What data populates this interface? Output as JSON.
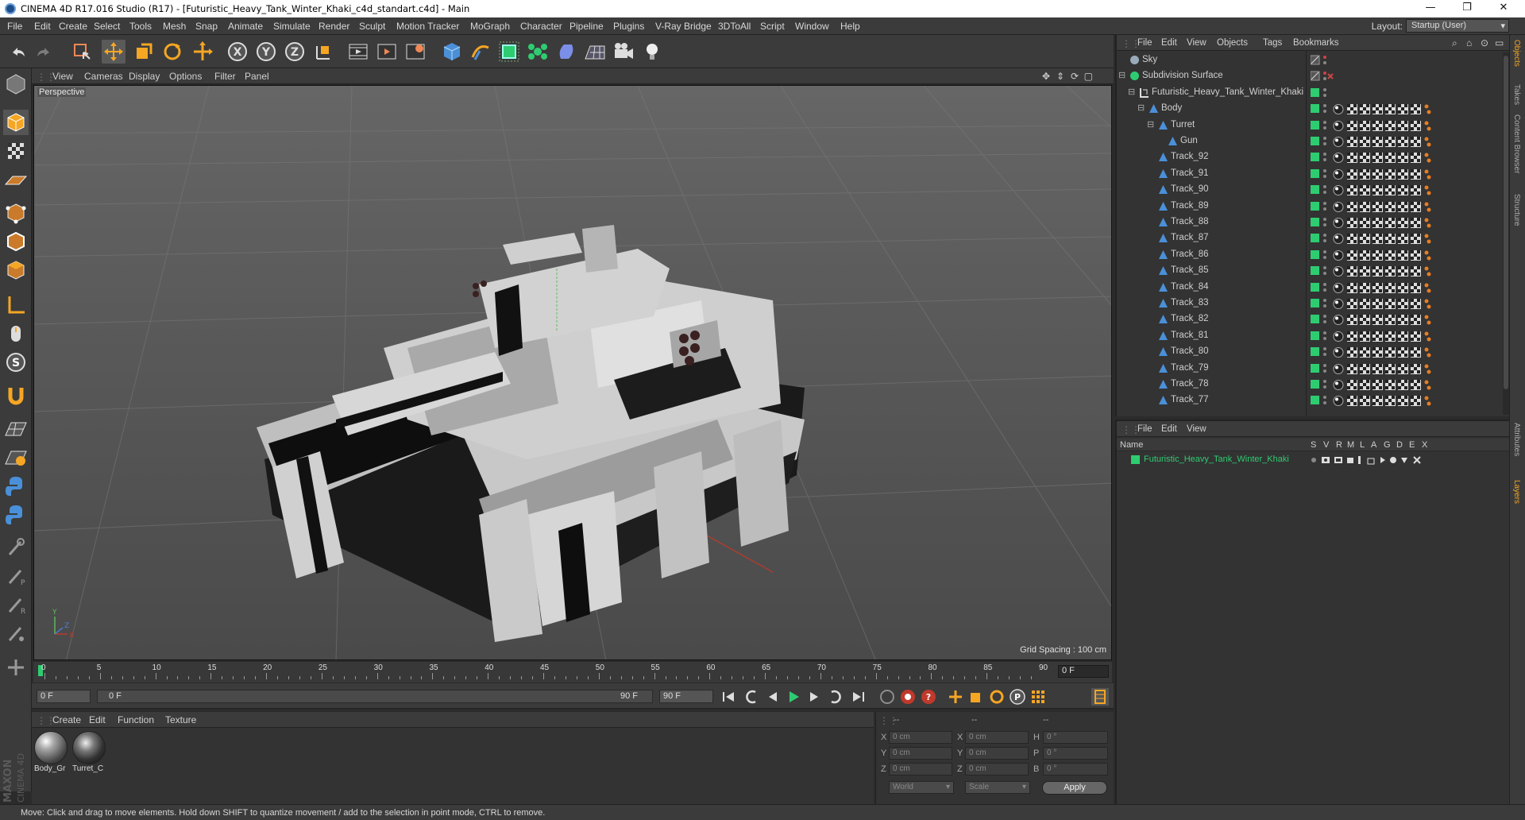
{
  "titlebar": {
    "title": "CINEMA 4D R17.016 Studio (R17) - [Futuristic_Heavy_Tank_Winter_Khaki_c4d_standart.c4d] - Main",
    "minimize": "—",
    "maximize": "❐",
    "close": "✕"
  },
  "menubar": {
    "items": [
      "File",
      "Edit",
      "Create",
      "Select",
      "Tools",
      "Mesh",
      "Snap",
      "Animate",
      "Simulate",
      "Render",
      "Sculpt",
      "Motion Tracker",
      "MoGraph",
      "Character",
      "Pipeline",
      "Plugins",
      "V-Ray Bridge",
      "3DToAll",
      "Script",
      "Window",
      "Help"
    ],
    "layout_label": "Layout:",
    "layout_value": "Startup (User)"
  },
  "viewport": {
    "menu": [
      "View",
      "Cameras",
      "Display",
      "Options",
      "Filter",
      "Panel"
    ],
    "label": "Perspective",
    "grid_spacing": "Grid Spacing : 100 cm"
  },
  "timeline": {
    "ticks": [
      "0",
      "5",
      "10",
      "15",
      "20",
      "25",
      "30",
      "35",
      "40",
      "45",
      "50",
      "55",
      "60",
      "65",
      "70",
      "75",
      "80",
      "85",
      "90"
    ],
    "current_frame": "0 F"
  },
  "playbar": {
    "start_frame": "0 F",
    "range_start": "0 F",
    "range_end": "90 F",
    "end_frame": "90 F"
  },
  "materials": {
    "menu": [
      "Create",
      "Edit",
      "Function",
      "Texture"
    ],
    "items": [
      {
        "name": "Body_Gr"
      },
      {
        "name": "Turret_C"
      }
    ]
  },
  "coords": {
    "header": [
      "--",
      "--",
      "--"
    ],
    "rows": [
      {
        "a": "X",
        "av": "0 cm",
        "b": "X",
        "bv": "0 cm",
        "c": "H",
        "cv": "0 °"
      },
      {
        "a": "Y",
        "av": "0 cm",
        "b": "Y",
        "bv": "0 cm",
        "c": "P",
        "cv": "0 °"
      },
      {
        "a": "Z",
        "av": "0 cm",
        "b": "Z",
        "bv": "0 cm",
        "c": "B",
        "cv": "0 °"
      }
    ],
    "mode": "World",
    "scale": "Scale",
    "apply": "Apply"
  },
  "statusbar": {
    "text": "Move: Click and drag to move elements. Hold down SHIFT to quantize movement / add to the selection in point mode, CTRL to remove."
  },
  "objects": {
    "menu": [
      "File",
      "Edit",
      "View",
      "Objects",
      "Tags",
      "Bookmarks"
    ],
    "rows": [
      {
        "name": "Sky",
        "depth": 0,
        "kind": "sky"
      },
      {
        "name": "Subdivision Surface",
        "depth": 0,
        "kind": "subd"
      },
      {
        "name": "Futuristic_Heavy_Tank_Winter_Khaki",
        "depth": 1,
        "kind": "null"
      },
      {
        "name": "Body",
        "depth": 2,
        "kind": "poly"
      },
      {
        "name": "Turret",
        "depth": 3,
        "kind": "poly"
      },
      {
        "name": "Gun",
        "depth": 4,
        "kind": "poly"
      },
      {
        "name": "Track_92",
        "depth": 3,
        "kind": "poly"
      },
      {
        "name": "Track_91",
        "depth": 3,
        "kind": "poly"
      },
      {
        "name": "Track_90",
        "depth": 3,
        "kind": "poly"
      },
      {
        "name": "Track_89",
        "depth": 3,
        "kind": "poly"
      },
      {
        "name": "Track_88",
        "depth": 3,
        "kind": "poly"
      },
      {
        "name": "Track_87",
        "depth": 3,
        "kind": "poly"
      },
      {
        "name": "Track_86",
        "depth": 3,
        "kind": "poly"
      },
      {
        "name": "Track_85",
        "depth": 3,
        "kind": "poly"
      },
      {
        "name": "Track_84",
        "depth": 3,
        "kind": "poly"
      },
      {
        "name": "Track_83",
        "depth": 3,
        "kind": "poly"
      },
      {
        "name": "Track_82",
        "depth": 3,
        "kind": "poly"
      },
      {
        "name": "Track_81",
        "depth": 3,
        "kind": "poly"
      },
      {
        "name": "Track_80",
        "depth": 3,
        "kind": "poly"
      },
      {
        "name": "Track_79",
        "depth": 3,
        "kind": "poly"
      },
      {
        "name": "Track_78",
        "depth": 3,
        "kind": "poly"
      },
      {
        "name": "Track_77",
        "depth": 3,
        "kind": "poly"
      }
    ]
  },
  "sidetabs": [
    "Objects",
    "Takes",
    "Content Browser",
    "Structure",
    "Attributes",
    "Layers"
  ],
  "layers": {
    "menu": [
      "File",
      "Edit",
      "View"
    ],
    "columns": [
      "Name",
      "S",
      "V",
      "R",
      "M",
      "L",
      "A",
      "G",
      "D",
      "E",
      "X"
    ],
    "rows": [
      {
        "name": "Futuristic_Heavy_Tank_Winter_Khaki",
        "color": "#2ecc71"
      }
    ]
  },
  "brand": {
    "line1": "MAXON",
    "line2": "CINEMA 4D"
  },
  "colors": {
    "accent": "#4a90d9",
    "layer_green": "#2ecc71",
    "panel": "#333333",
    "toolbar": "#3b3b3b"
  }
}
